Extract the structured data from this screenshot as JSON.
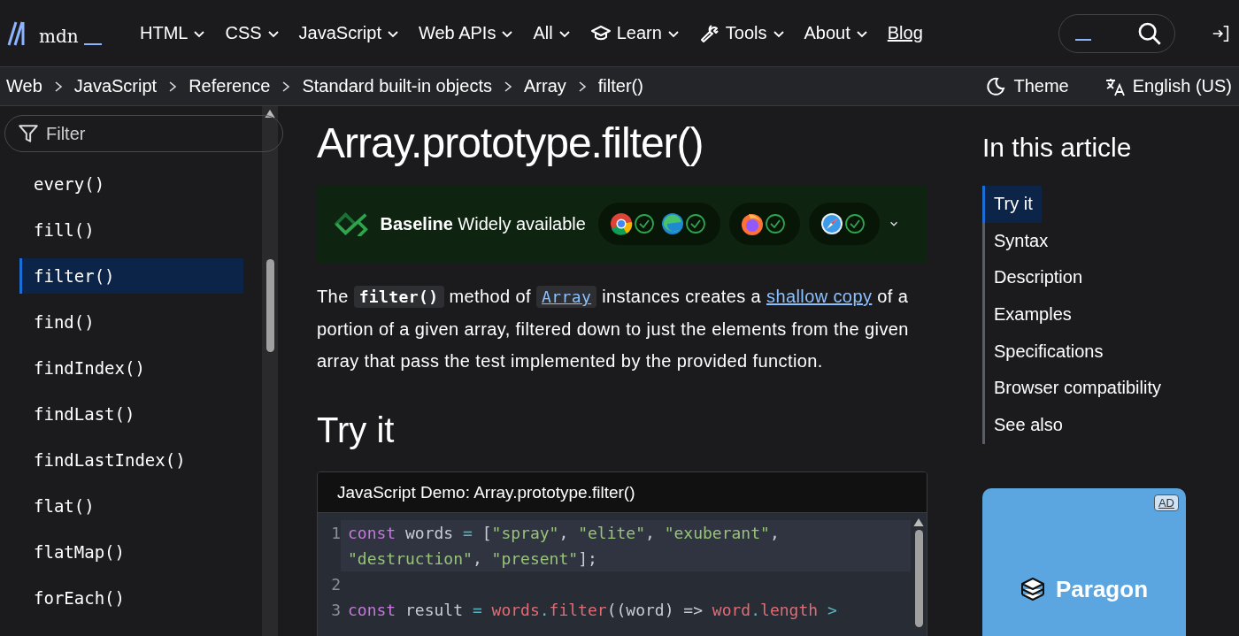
{
  "header": {
    "logo": "mdn",
    "nav": [
      {
        "label": "HTML",
        "kind": "menu"
      },
      {
        "label": "CSS",
        "kind": "menu"
      },
      {
        "label": "JavaScript",
        "kind": "menu"
      },
      {
        "label": "Web APIs",
        "kind": "menu"
      },
      {
        "label": "All",
        "kind": "menu"
      },
      {
        "label": "Learn",
        "kind": "icon-menu"
      },
      {
        "label": "Tools",
        "kind": "icon-menu"
      },
      {
        "label": "About",
        "kind": "menu"
      },
      {
        "label": "Blog",
        "kind": "link"
      }
    ]
  },
  "breadcrumbs": [
    "Web",
    "JavaScript",
    "Reference",
    "Standard built-in objects",
    "Array",
    "filter()"
  ],
  "toolbar": {
    "theme": "Theme",
    "language": "English (US)"
  },
  "sidebar": {
    "filter_placeholder": "Filter",
    "items": [
      {
        "label": "every()",
        "selected": false
      },
      {
        "label": "fill()",
        "selected": false
      },
      {
        "label": "filter()",
        "selected": true
      },
      {
        "label": "find()",
        "selected": false
      },
      {
        "label": "findIndex()",
        "selected": false
      },
      {
        "label": "findLast()",
        "selected": false
      },
      {
        "label": "findLastIndex()",
        "selected": false
      },
      {
        "label": "flat()",
        "selected": false
      },
      {
        "label": "flatMap()",
        "selected": false
      },
      {
        "label": "forEach()",
        "selected": false
      }
    ]
  },
  "article": {
    "title": "Array.prototype.filter()",
    "baseline": "**Baseline** Widely available",
    "description": [
      {
        "kind": "text",
        "text": "The "
      },
      {
        "kind": "code",
        "text": "filter()"
      },
      {
        "kind": "text",
        "text": " method of "
      },
      {
        "kind": "code-link",
        "text": "Array"
      },
      {
        "kind": "text",
        "text": " instances creates a "
      },
      {
        "kind": "link",
        "text": "shallow copy"
      },
      {
        "kind": "text",
        "text": " of a portion of a given array, filtered down to just the elements from the given array that pass the test implemented by the provided function."
      }
    ],
    "section": "Try it",
    "demo": {
      "title": "JavaScript Demo: Array.prototype.filter()",
      "lines": [
        {
          "number": "1",
          "current": true,
          "rows": [
            {
              "segments": [
                {
                  "kind": "keyword",
                  "text": "const"
                },
                {
                  "kind": "plain",
                  "text": " words"
                },
                {
                  "kind": "op",
                  "text": " = "
                },
                {
                  "kind": "plain",
                  "text": "["
                },
                {
                  "kind": "string",
                  "text": "\"spray\""
                },
                {
                  "kind": "plain",
                  "text": ", "
                },
                {
                  "kind": "string",
                  "text": "\"elite\""
                },
                {
                  "kind": "plain",
                  "text": ", "
                },
                {
                  "kind": "string",
                  "text": "\"exuberant\""
                },
                {
                  "kind": "plain",
                  "text": ","
                }
              ]
            },
            {
              "segments": [
                {
                  "kind": "string",
                  "text": "\"destruction\""
                },
                {
                  "kind": "plain",
                  "text": ", "
                },
                {
                  "kind": "string",
                  "text": "\"present\""
                },
                {
                  "kind": "plain",
                  "text": "];"
                }
              ]
            }
          ]
        },
        {
          "number": "2",
          "current": false,
          "rows": [
            {
              "segments": []
            }
          ]
        },
        {
          "number": "3",
          "current": false,
          "rows": [
            {
              "segments": [
                {
                  "kind": "keyword",
                  "text": "const"
                },
                {
                  "kind": "plain",
                  "text": " result"
                },
                {
                  "kind": "op",
                  "text": " = "
                },
                {
                  "kind": "variable",
                  "text": "words"
                },
                {
                  "kind": "op",
                  "text": "."
                },
                {
                  "kind": "variable",
                  "text": "filter"
                },
                {
                  "kind": "plain",
                  "text": "((word) => "
                },
                {
                  "kind": "variable",
                  "text": "word"
                },
                {
                  "kind": "op",
                  "text": "."
                },
                {
                  "kind": "variable",
                  "text": "length"
                },
                {
                  "kind": "op",
                  "text": " >"
                }
              ]
            }
          ]
        }
      ]
    }
  },
  "toc": {
    "title": "In this article",
    "items": [
      {
        "label": "Try it",
        "selected": true
      },
      {
        "label": "Syntax",
        "selected": false
      },
      {
        "label": "Description",
        "selected": false
      },
      {
        "label": "Examples",
        "selected": false
      },
      {
        "label": "Specifications",
        "selected": false
      },
      {
        "label": "Browser compatibility",
        "selected": false
      },
      {
        "label": "See also",
        "selected": false
      }
    ]
  },
  "ad": {
    "badge": "AD",
    "brand": "Paragon"
  }
}
